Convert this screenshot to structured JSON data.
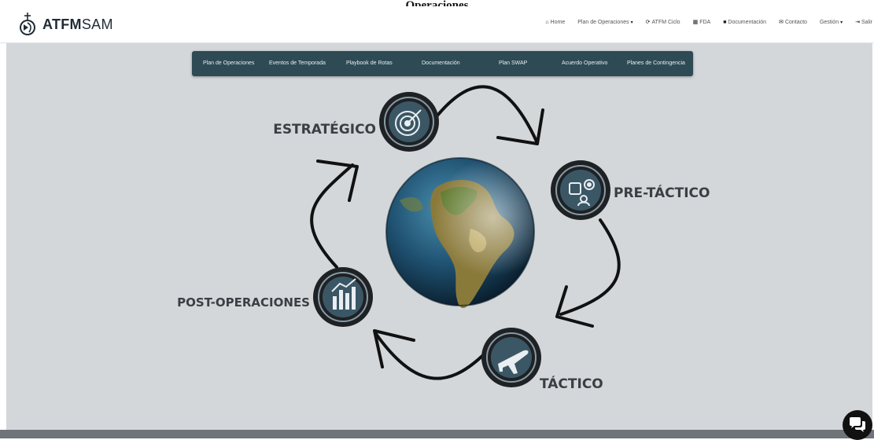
{
  "page": {
    "heading": "Operaciones"
  },
  "brand": {
    "name_bold": "ATFM",
    "name_light": "SAM"
  },
  "nav": [
    {
      "label": "Home",
      "icon": "home-icon",
      "glyph": "⌂",
      "dropdown": false
    },
    {
      "label": "Plan de Operaciones",
      "icon": "",
      "glyph": "",
      "dropdown": true
    },
    {
      "label": "ATFM Ciclo",
      "icon": "refresh-icon",
      "glyph": "⟳",
      "dropdown": false
    },
    {
      "label": "FDA",
      "icon": "table-icon",
      "glyph": "▦",
      "dropdown": false
    },
    {
      "label": "Documentación",
      "icon": "book-icon",
      "glyph": "■",
      "dropdown": false
    },
    {
      "label": "Contacto",
      "icon": "envelope-icon",
      "glyph": "✉",
      "dropdown": false
    },
    {
      "label": "Gestión",
      "icon": "",
      "glyph": "",
      "dropdown": true
    },
    {
      "label": "Salir",
      "icon": "sign-out-icon",
      "glyph": "⇥",
      "dropdown": false
    }
  ],
  "subnav": [
    "Plan de Operaciones",
    "Eventos de Temporada",
    "Playbook de Rotas",
    "Documentación",
    "Plan SWAP",
    "Acuerdo Operativo",
    "Planes de Contingencia"
  ],
  "phases": {
    "strategic": "ESTRATÉGICO",
    "pretactical": "PRE-TÁCTICO",
    "tactical": "TÁCTICO",
    "postops": "POST-OPERACIONES"
  },
  "colors": {
    "subnav_bg": "#2e4a54",
    "main_bg": "#d3d7da",
    "badge_ring": "#1e2225",
    "badge_inner": "#3b5766"
  }
}
